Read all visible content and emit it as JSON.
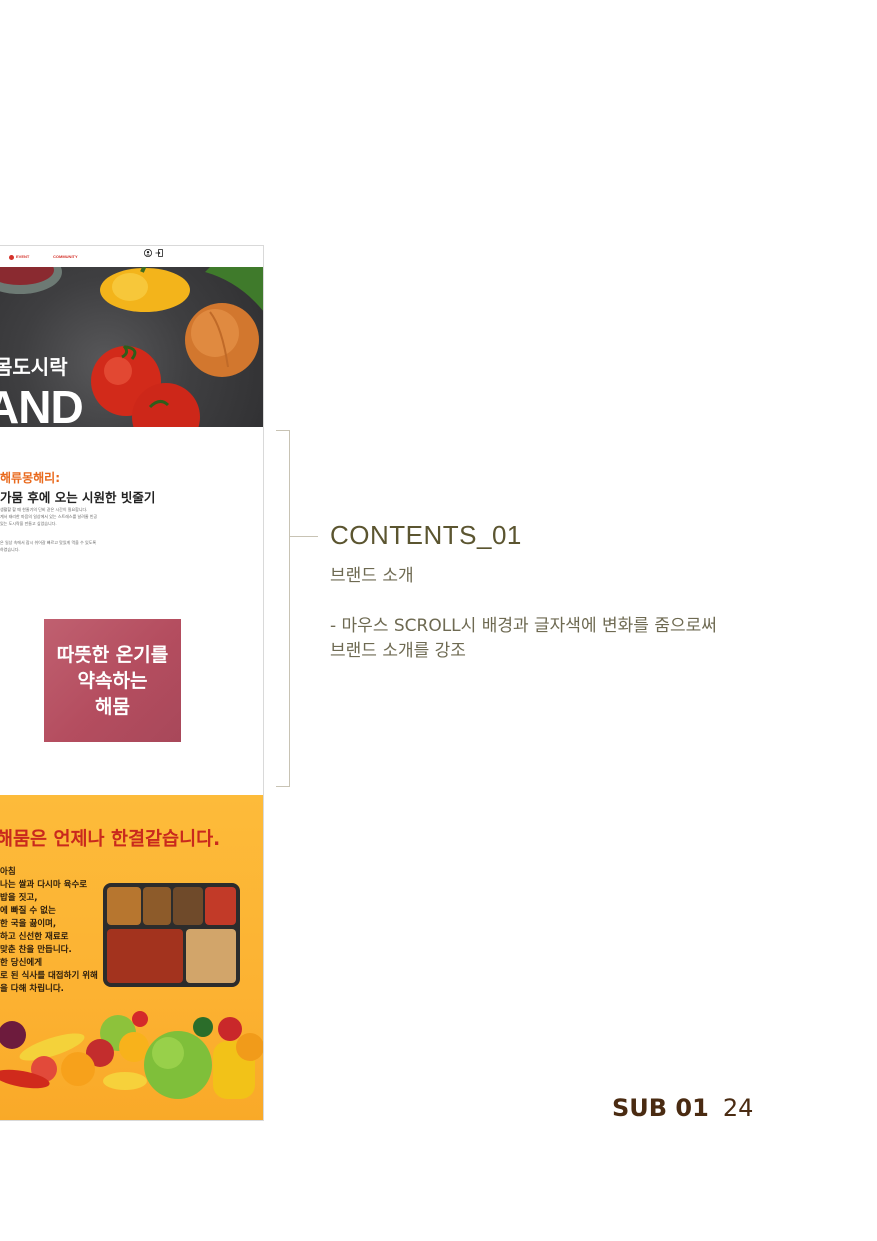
{
  "mockup": {
    "nav": {
      "event": "EVENT",
      "community": "COMMUNITY"
    },
    "hero": {
      "line1": "몸도시락",
      "line2": "AND"
    },
    "intro": {
      "orange_label": "해류몽해리:",
      "headline": "가뭄 후에 오는 시원한 빗줄기",
      "small_lines": [
        "생활할 할 때 한줄기의 단비 같은 시간이 필요합니다.",
        "계서 태리한 마음의 일상에서 있는 스트레스를 날려줄 빈공",
        "있는 도시락을 만들고 싶었습니다.",
        "",
        "은 일상 속에서 잠시 쉬어갈 빠르고 맛있게 먹을 수 있도록",
        "하였습니다."
      ]
    },
    "pink_box": [
      "따뜻한 온기를",
      "약속하는",
      "해뭄"
    ],
    "yellow": {
      "title": "해뭄은 언제나 한결같습니다.",
      "lines": [
        "아침",
        "나는 쌀과 다시마 육수로",
        "밥을 짓고,",
        "에 빠질 수 없는",
        "한 국을 끓이며,",
        "하고 신선한 재료로",
        "맞춘 찬을 만듭니다.",
        "한 당신에게",
        "로 된 식사를 대접하기 위해",
        "을 다해 차립니다."
      ]
    }
  },
  "annotation": {
    "title": "CONTENTS_01",
    "subtitle": "브랜드 소개",
    "description": [
      "- 마우스 SCROLL시 배경과 글자색에 변화를 줌으로써",
      "브랜드 소개를 강조"
    ]
  },
  "footer": {
    "section": "SUB 01",
    "page": "24"
  },
  "colors": {
    "accent_text": "#5b5530",
    "orange": "#e9691c",
    "red": "#c9291d",
    "pink": "#b44d5f",
    "yellow": "#fcb232",
    "footer": "#4a2b12"
  }
}
